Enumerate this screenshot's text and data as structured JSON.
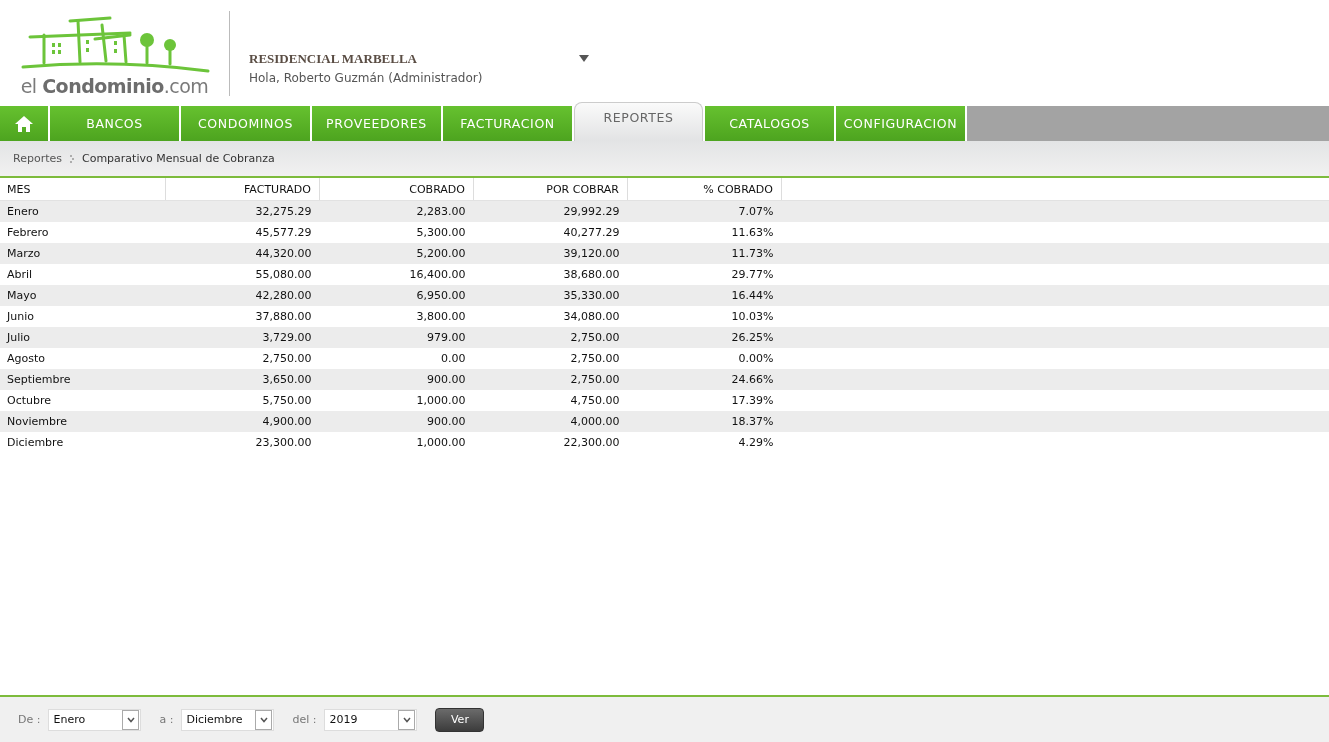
{
  "logo": {
    "prefix": "el ",
    "brand": "Condominio",
    ".com": ".com"
  },
  "account": {
    "condominium": "RESIDENCIAL MARBELLA",
    "greeting": "Hola, Roberto Guzmán (Administrador)"
  },
  "tabs": [
    {
      "kind": "home",
      "selected": false
    },
    {
      "kind": "text",
      "label": "BANCOS",
      "selected": false
    },
    {
      "kind": "text",
      "label": "CONDOMINOS",
      "selected": false
    },
    {
      "kind": "text",
      "label": "PROVEEDORES",
      "selected": false
    },
    {
      "kind": "text",
      "label": "FACTURACION",
      "selected": false
    },
    {
      "kind": "text",
      "label": "REPORTES",
      "selected": true
    },
    {
      "kind": "text",
      "label": "CATALOGOS",
      "selected": false
    },
    {
      "kind": "text",
      "label": "CONFIGURACION",
      "selected": false
    }
  ],
  "breadcrumb": [
    "Reportes",
    "Comparativo Mensual de Cobranza"
  ],
  "table": {
    "columns": [
      "MES",
      "FACTURADO",
      "COBRADO",
      "POR COBRAR",
      "% COBRADO"
    ],
    "rows": [
      [
        "Enero",
        "32,275.29",
        "2,283.00",
        "29,992.29",
        "7.07%"
      ],
      [
        "Febrero",
        "45,577.29",
        "5,300.00",
        "40,277.29",
        "11.63%"
      ],
      [
        "Marzo",
        "44,320.00",
        "5,200.00",
        "39,120.00",
        "11.73%"
      ],
      [
        "Abril",
        "55,080.00",
        "16,400.00",
        "38,680.00",
        "29.77%"
      ],
      [
        "Mayo",
        "42,280.00",
        "6,950.00",
        "35,330.00",
        "16.44%"
      ],
      [
        "Junio",
        "37,880.00",
        "3,800.00",
        "34,080.00",
        "10.03%"
      ],
      [
        "Julio",
        "3,729.00",
        "979.00",
        "2,750.00",
        "26.25%"
      ],
      [
        "Agosto",
        "2,750.00",
        "0.00",
        "2,750.00",
        "0.00%"
      ],
      [
        "Septiembre",
        "3,650.00",
        "900.00",
        "2,750.00",
        "24.66%"
      ],
      [
        "Octubre",
        "5,750.00",
        "1,000.00",
        "4,750.00",
        "17.39%"
      ],
      [
        "Noviembre",
        "4,900.00",
        "900.00",
        "4,000.00",
        "18.37%"
      ],
      [
        "Diciembre",
        "23,300.00",
        "1,000.00",
        "22,300.00",
        "4.29%"
      ]
    ]
  },
  "filters": [
    {
      "label": "De :",
      "value": "Enero"
    },
    {
      "label": "a :",
      "value": "Diciembre"
    },
    {
      "label": "del :",
      "value": "2019"
    }
  ],
  "submit": "Ver"
}
